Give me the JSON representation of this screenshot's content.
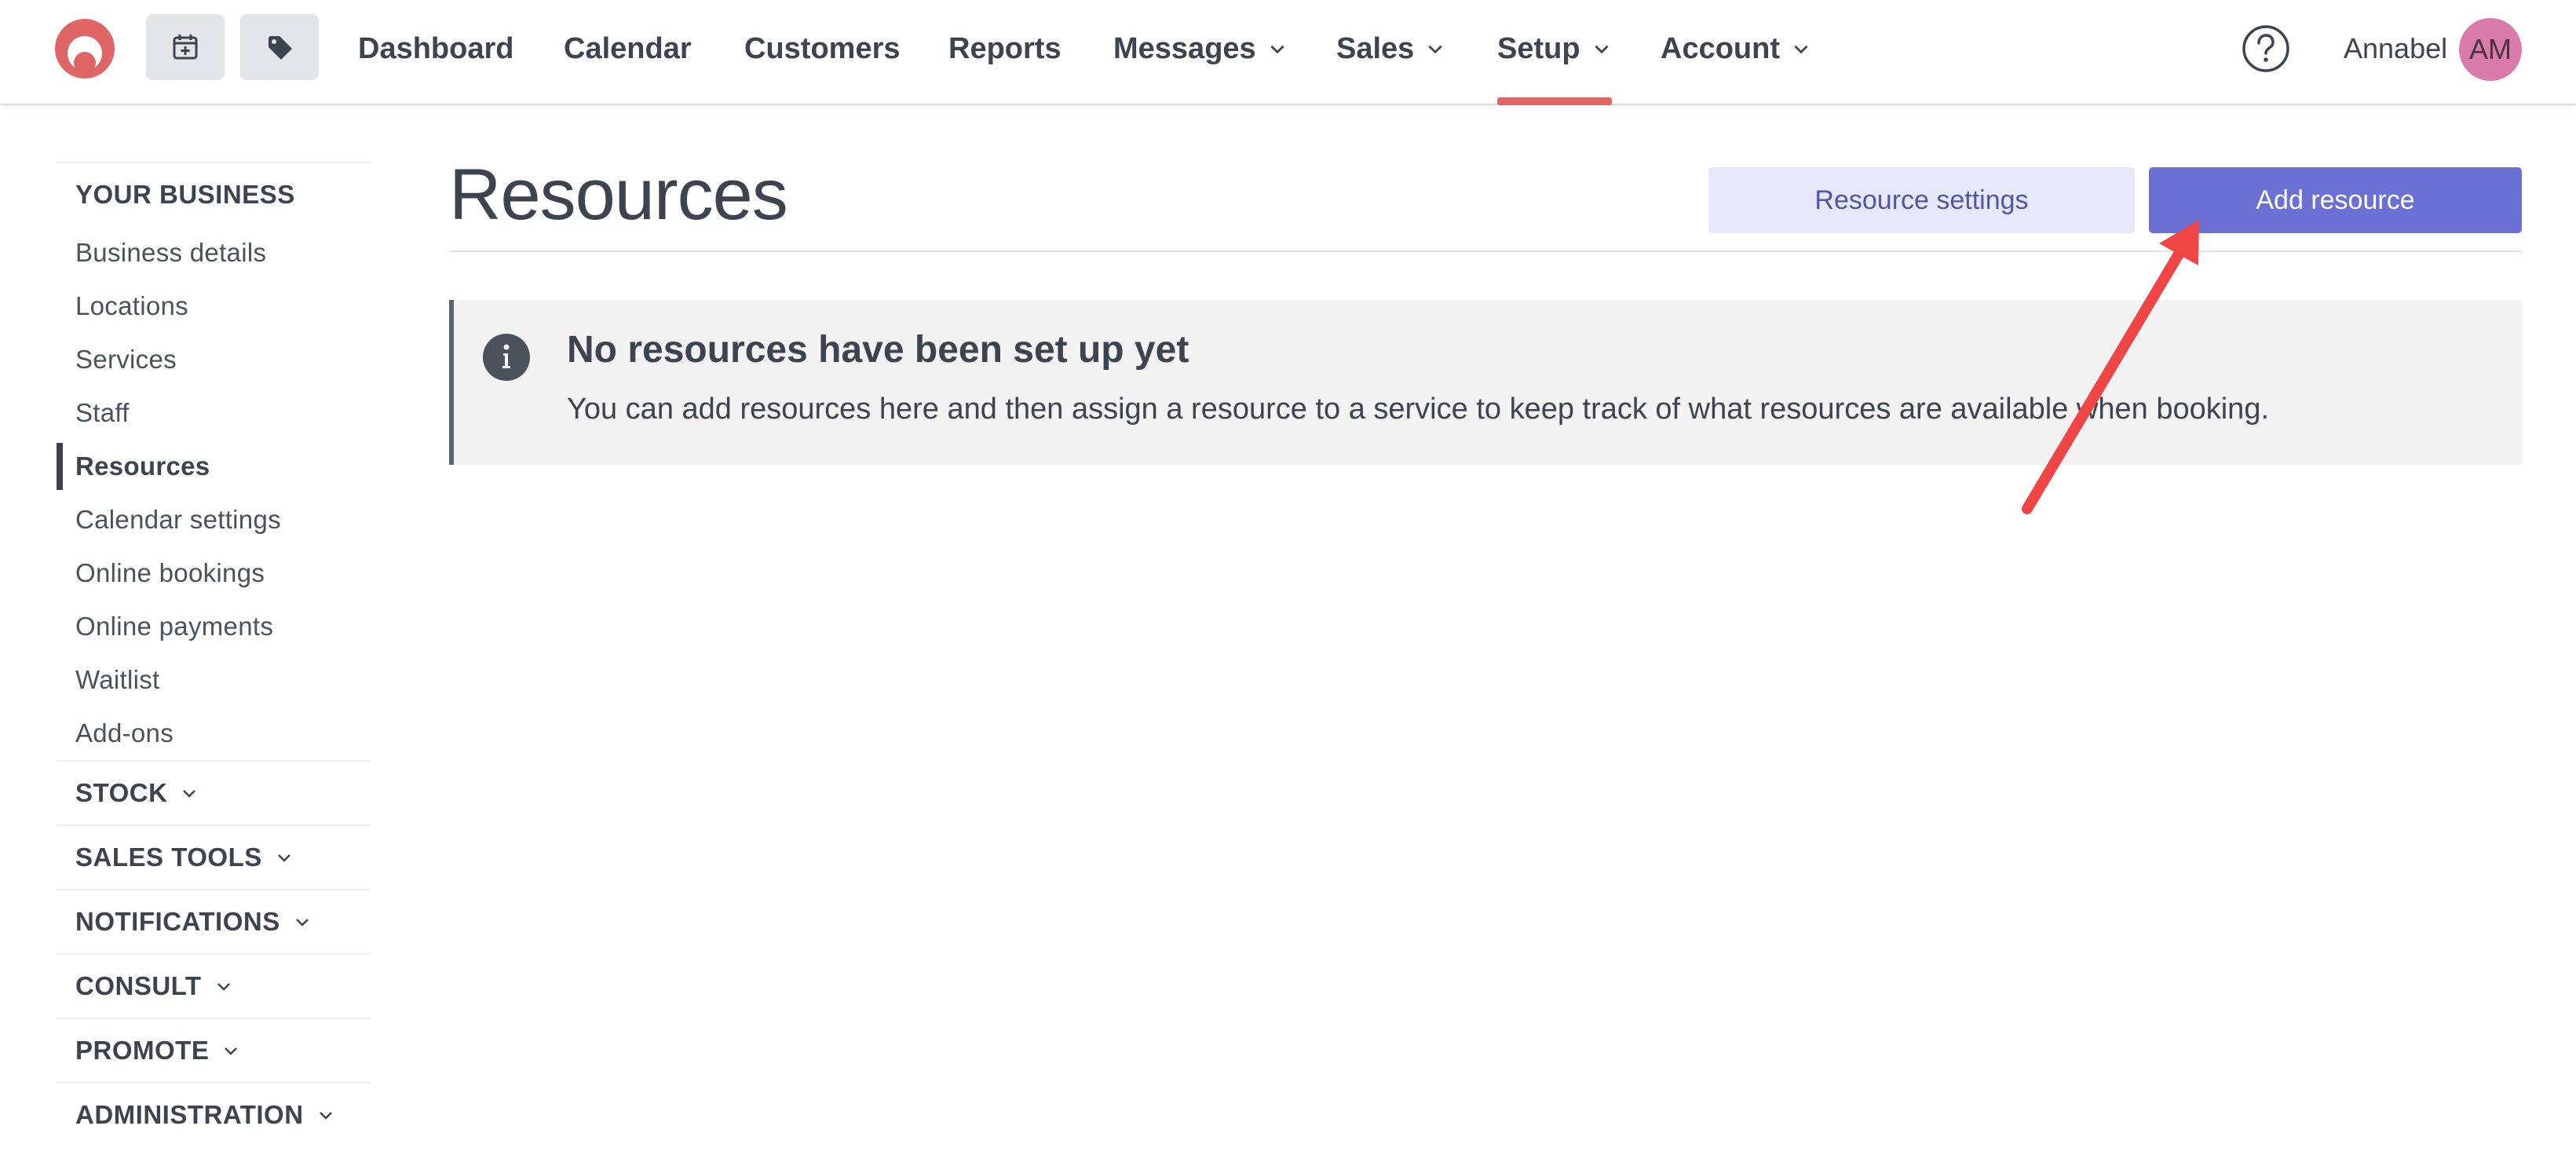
{
  "nav": {
    "items": [
      {
        "label": "Dashboard",
        "dropdown": false,
        "active": false
      },
      {
        "label": "Calendar",
        "dropdown": false,
        "active": false
      },
      {
        "label": "Customers",
        "dropdown": false,
        "active": false
      },
      {
        "label": "Reports",
        "dropdown": false,
        "active": false
      },
      {
        "label": "Messages",
        "dropdown": true,
        "active": false
      },
      {
        "label": "Sales",
        "dropdown": true,
        "active": false
      },
      {
        "label": "Setup",
        "dropdown": true,
        "active": true
      },
      {
        "label": "Account",
        "dropdown": true,
        "active": false
      }
    ],
    "quick_buttons": [
      "calendar-plus-icon",
      "tag-icon"
    ],
    "help_icon": "help-icon",
    "user_name": "Annabel",
    "avatar_initials": "AM"
  },
  "sidebar": {
    "heading": "YOUR BUSINESS",
    "links": [
      {
        "label": "Business details",
        "active": false
      },
      {
        "label": "Locations",
        "active": false
      },
      {
        "label": "Services",
        "active": false
      },
      {
        "label": "Staff",
        "active": false
      },
      {
        "label": "Resources",
        "active": true
      },
      {
        "label": "Calendar settings",
        "active": false
      },
      {
        "label": "Online bookings",
        "active": false
      },
      {
        "label": "Online payments",
        "active": false
      },
      {
        "label": "Waitlist",
        "active": false
      },
      {
        "label": "Add-ons",
        "active": false
      }
    ],
    "sections": [
      "STOCK",
      "SALES TOOLS",
      "NOTIFICATIONS",
      "CONSULT",
      "PROMOTE",
      "ADMINISTRATION"
    ]
  },
  "main": {
    "title": "Resources",
    "settings_button": "Resource settings",
    "add_button": "Add resource",
    "notice": {
      "icon": "info-icon",
      "title": "No resources have been set up yet",
      "body": "You can add resources here and then assign a resource to a service to keep track of what resources are available when booking."
    }
  },
  "colors": {
    "brand": "#e06666",
    "primary_button": "#6b70d4",
    "secondary_button": "#e7e8fb",
    "annotation_arrow": "#f04545",
    "avatar": "#d97bab"
  }
}
